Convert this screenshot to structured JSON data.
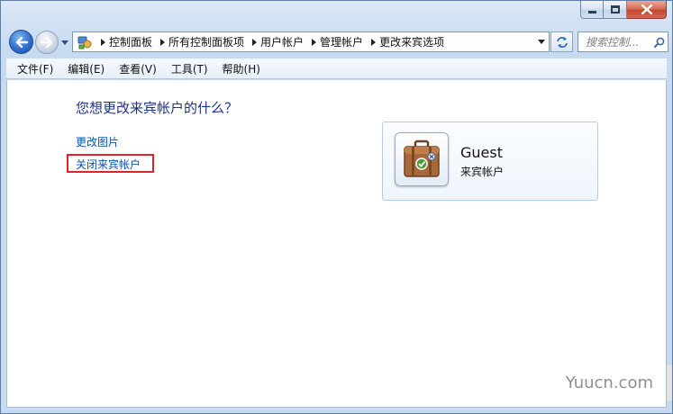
{
  "window": {
    "caption_buttons": [
      "minimize",
      "maximize",
      "close"
    ]
  },
  "navigation": {
    "breadcrumbs": [
      "控制面板",
      "所有控制面板项",
      "用户帐户",
      "管理帐户",
      "更改来宾选项"
    ],
    "search_placeholder": "搜索控制..."
  },
  "menubar": {
    "items": [
      "文件(F)",
      "编辑(E)",
      "查看(V)",
      "工具(T)",
      "帮助(H)"
    ]
  },
  "content": {
    "heading": "您想更改来宾帐户的什么？",
    "links": [
      "更改图片",
      "关闭来宾帐户"
    ],
    "highlighted_link": "关闭来宾帐户",
    "account": {
      "name": "Guest",
      "type": "来宾帐户",
      "picture_icon": "suitcase-icon"
    }
  },
  "watermark": "Yuucn.com",
  "colors": {
    "link": "#0a52a8",
    "heading": "#1e3287",
    "highlight": "#e0222a"
  }
}
